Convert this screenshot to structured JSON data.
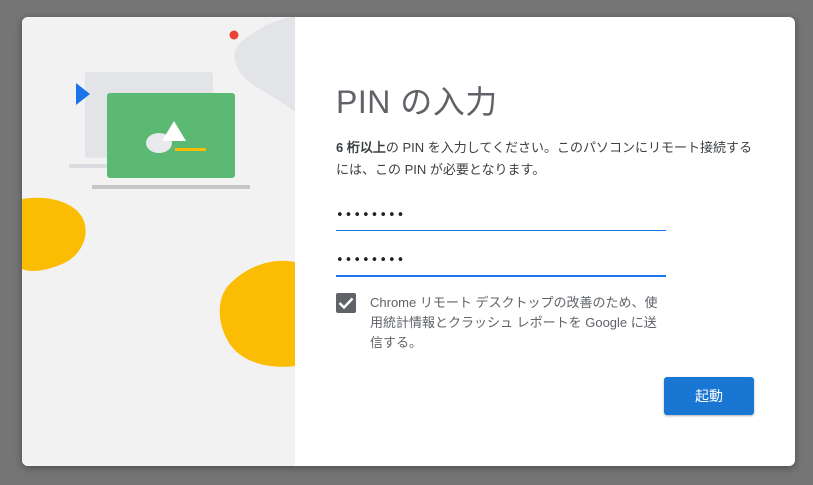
{
  "dialog": {
    "title": "PIN の入力",
    "description": {
      "strong": "6 桁以上",
      "rest": "の PIN を入力してください。このパソコンにリモート接続するには、この PIN が必要となります。"
    },
    "pin_field": {
      "value": "••••••••"
    },
    "pin_confirm_field": {
      "value": "••••••••"
    },
    "consent": {
      "checked": true,
      "label": "Chrome リモート デスクトップの改善のため、使用統計情報とクラッシュ レポートを Google に送信する。"
    },
    "start_button": {
      "label": "起動"
    }
  },
  "colors": {
    "accent": "#1976d2",
    "illustration_yellow": "#fbbc04",
    "illustration_green": "#5bb974",
    "illustration_red": "#ea4335"
  },
  "icons": [
    "play-triangle-icon",
    "warning-triangle-icon",
    "check-icon"
  ]
}
